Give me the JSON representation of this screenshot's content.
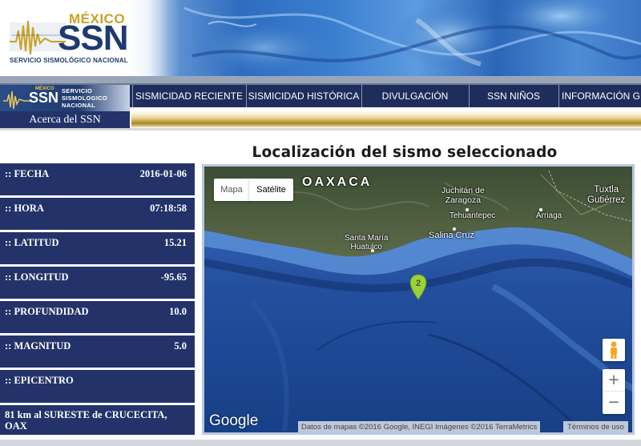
{
  "header": {
    "logo_country": "MÉXICO",
    "logo_acronym": "SSN",
    "logo_full_name": "SERVICIO SISMOLÓGICO NACIONAL"
  },
  "nav": {
    "logo_country": "MÉXICO",
    "logo_acronym": "SSN",
    "logo_line1": "SERVICIO",
    "logo_line2": "SISMOLOGICO",
    "logo_line3": "NACIONAL",
    "about": "Acerca del SSN",
    "items": [
      {
        "label": "SISMICIDAD RECIENTE"
      },
      {
        "label": "SISMICIDAD HISTÓRICA"
      },
      {
        "label": "DIVULGACIÓN"
      },
      {
        "label": "SSN NIÑOS"
      },
      {
        "label": "INFORMACIÓN GE"
      }
    ]
  },
  "page_title": "Localización del sismo seleccionado",
  "earthquake": {
    "fecha_label": ":: FECHA",
    "fecha": "2016-01-06",
    "hora_label": ":: HORA",
    "hora": "07:18:58",
    "latitud_label": ":: LATITUD",
    "latitud": "15.21",
    "longitud_label": ":: LONGITUD",
    "longitud": "-95.65",
    "profundidad_label": ":: PROFUNDIDAD",
    "profundidad": "10.0",
    "magnitud_label": ":: MAGNITUD",
    "magnitud": "5.0",
    "epicentro_label": ":: EPICENTRO",
    "epicentro": "81 km al SURESTE de CRUCECITA, OAX"
  },
  "map": {
    "type_map": "Mapa",
    "type_satellite": "Satélite",
    "selected_type": "Satélite",
    "marker_label": "2",
    "marker_color": "#9bd13b",
    "labels": {
      "oaxaca": "OAXACA",
      "juchitan": "Juchitán de\nZaragoza",
      "tehuantepec": "Tehuantepec",
      "salina_cruz": "Salina Cruz",
      "santa_maria": "Santa María\nHuatulco",
      "arriaga": "Arriaga",
      "tuxtla": "Tuxtla\nGutiérrez"
    },
    "zoom_in": "+",
    "zoom_out": "−",
    "google_logo": "Google",
    "attribution": "Datos de mapas ©2016 Google, INEGI Imágenes ©2016 TerraMetrics",
    "terms": "Términos de uso"
  },
  "colors": {
    "navy": "#23336a",
    "gold": "#c9a227",
    "ocean": "#1f4f9c"
  }
}
